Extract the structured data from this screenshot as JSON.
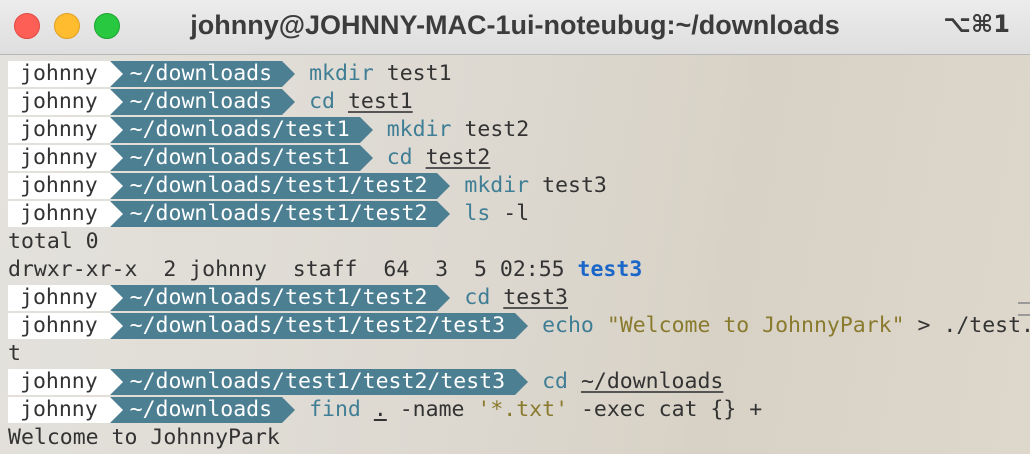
{
  "window": {
    "title": "johnny@JOHNNY-MAC-1ui-noteubug:~/downloads",
    "shortcut": "⌥⌘1"
  },
  "terminal": {
    "user": "johnny",
    "lines": [
      {
        "path": "~/downloads",
        "cmd": "mkdir",
        "args": [
          "test1"
        ]
      },
      {
        "path": "~/downloads",
        "cmd": "cd",
        "args": [
          "test1"
        ]
      },
      {
        "path": "~/downloads/test1",
        "cmd": "mkdir",
        "args": [
          "test2"
        ]
      },
      {
        "path": "~/downloads/test1",
        "cmd": "cd",
        "args": [
          "test2"
        ]
      },
      {
        "path": "~/downloads/test1/test2",
        "cmd": "mkdir",
        "args": [
          "test3"
        ]
      },
      {
        "path": "~/downloads/test1/test2",
        "cmd": "ls",
        "args": [
          "-l"
        ]
      }
    ],
    "output_total": "total 0",
    "output_ls_prefix": "drwxr-xr-x  2 johnny  staff  64  3  5 02:55 ",
    "output_ls_dir": "test3",
    "line7": {
      "path": "~/downloads/test1/test2",
      "cmd": "cd",
      "arg": "test3"
    },
    "line8": {
      "path": "~/downloads/test1/test2/test3",
      "cmd": "echo",
      "str": "\"Welcome to JohnnyPark\"",
      "rest": " > ./test.tx"
    },
    "line8_wrap": "t",
    "line9": {
      "path": "~/downloads/test1/test2/test3",
      "cmd": "cd",
      "arg": "~/downloads"
    },
    "line10": {
      "path": "~/downloads",
      "cmd": "find",
      "dot": ".",
      "rest": " -name ",
      "str": "'*.txt'",
      "tail": " -exec cat {} +"
    },
    "output_final": "Welcome to JohnnyPark"
  }
}
